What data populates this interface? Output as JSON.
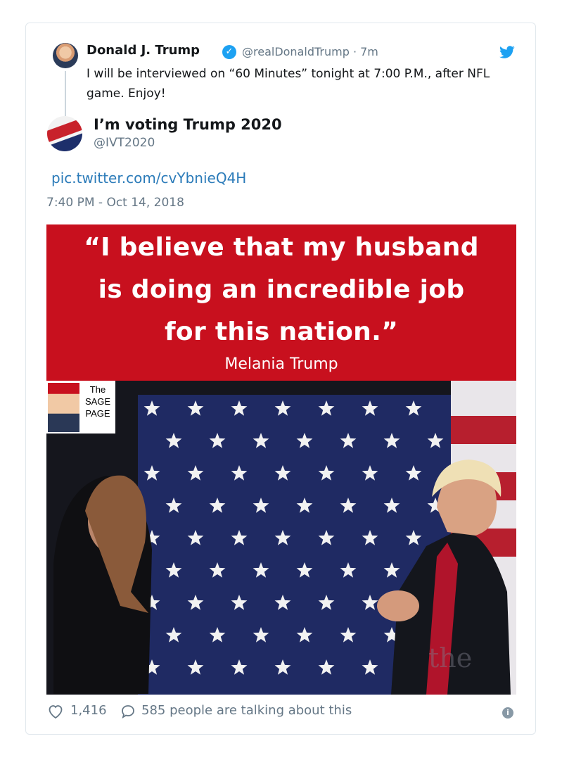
{
  "tweet": {
    "author_name": "Donald J. Trump",
    "handle": "@realDonaldTrump",
    "separator": " · ",
    "time_ago": "7m",
    "text": "I will be interviewed on “60 Minutes” tonight at 7:00 P.M., after NFL game. Enjoy!"
  },
  "quoted": {
    "author_name": "I’m voting Trump 2020",
    "handle": "@IVT2020",
    "link": "pic.twitter.com/cvYbnieQ4H",
    "timestamp": "7:40 PM - Oct 14, 2018"
  },
  "image": {
    "quote_lines": [
      "“I believe that my husband",
      "is doing an incredible job",
      "for this nation.”"
    ],
    "attribution": "Melania Trump",
    "badge_lines": [
      "The",
      "SAGE",
      "PAGE"
    ],
    "watermark": "the"
  },
  "footer": {
    "likes": "1,416",
    "talking": "585 people are talking about this"
  },
  "colors": {
    "link": "#2b7bb9",
    "verified": "#1da1f2",
    "banner_red": "#c8101e",
    "muted": "#657786"
  },
  "icons": [
    "verified-badge-icon",
    "twitter-bird-icon",
    "heart-icon",
    "reply-bubble-icon",
    "info-icon"
  ]
}
